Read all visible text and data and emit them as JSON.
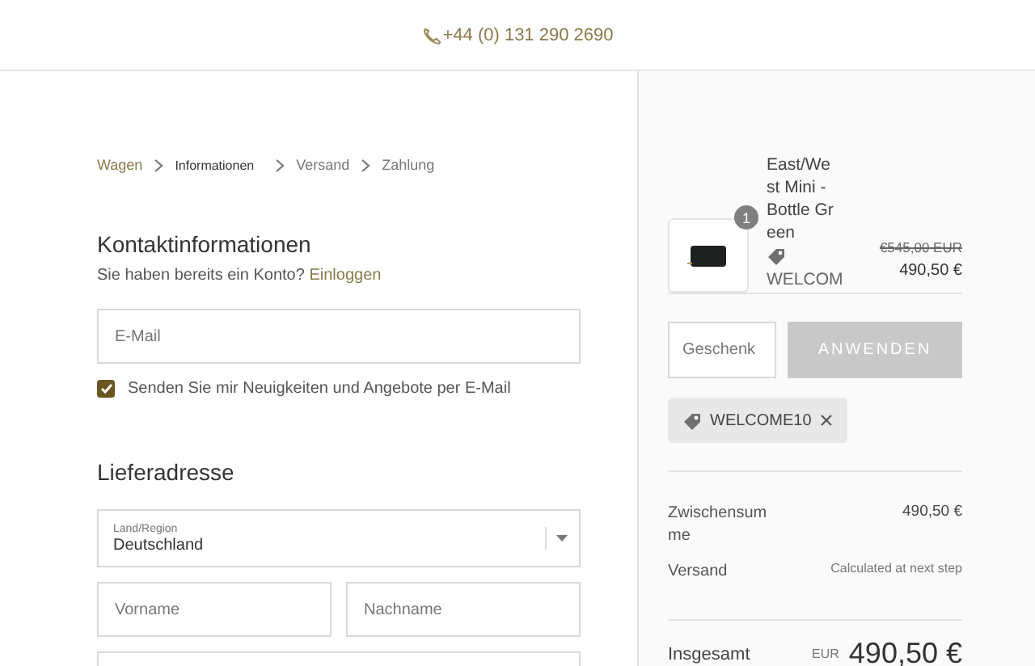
{
  "header": {
    "phone": "+44 (0) 131 290 2690"
  },
  "breadcrumb": [
    {
      "label": "Wagen",
      "selected": false,
      "link": true
    },
    {
      "label": "Informationen",
      "selected": true,
      "link": false
    },
    {
      "label": "Versand",
      "selected": false,
      "link": false
    },
    {
      "label": "Zahlung",
      "selected": false,
      "link": false
    }
  ],
  "contact": {
    "title": "Kontaktinformationen",
    "prompt": "Sie haben bereits ein Konto?",
    "login_link": "Einloggen",
    "email": {
      "placeholder": "E-Mail"
    },
    "newsletter": {
      "label": "Senden Sie mir Neuigkeiten und Angebote per E-Mail",
      "checked": true
    }
  },
  "shipping": {
    "title": "Lieferadresse",
    "country": {
      "label": "Land/Region",
      "value": "Deutschland"
    },
    "first_name": {
      "placeholder": "Vorname"
    },
    "last_name": {
      "placeholder": "Nachname"
    }
  },
  "summary": {
    "items": [
      {
        "quantity": "1",
        "name": "East/West Mini - Bottle Green",
        "discount": "WELCOM",
        "old_price": "€545,00 EUR",
        "price": "490,50 €"
      }
    ],
    "gift_field": {
      "placeholder": "Geschenk"
    },
    "apply_button": {
      "label": "ANWENDEN",
      "disabled": true
    },
    "applied_codes": [
      "WELCOME10"
    ],
    "subtotal": {
      "label": "Zwischensumme",
      "value": "490,50 €"
    },
    "shipping": {
      "label": "Versand",
      "value": "Calculated at next step"
    },
    "total": {
      "label": "Insgesamt",
      "currency": "EUR",
      "value": "490,50 €"
    }
  }
}
